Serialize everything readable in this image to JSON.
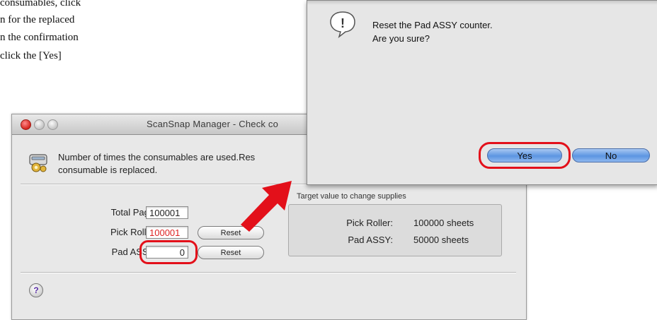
{
  "doc": {
    "line1": "consumables, click",
    "line2": "n  for  the  replaced",
    "line3": "n  the  confirmation",
    "line4": "click  the  [Yes]"
  },
  "main_window": {
    "title": "ScanSnap Manager - Check co",
    "info_line1": "Number of times the consumables are used.Res",
    "info_line2": "consumable is replaced.",
    "total_label": "Total Page Count:",
    "total_value": "100001",
    "pick_label": "Pick Roller Count:",
    "pick_value": "100001",
    "pad_label": "Pad ASSY Count:",
    "pad_value": "0",
    "reset_label": "Reset",
    "group_title": "Target value to change supplies",
    "target_pick_name": "Pick Roller:",
    "target_pick_value": "100000  sheets",
    "target_pad_name": "Pad ASSY:",
    "target_pad_value": "50000  sheets",
    "help_symbol": "?"
  },
  "dialog": {
    "message_line1": "Reset the Pad ASSY counter.",
    "message_line2": "Are you sure?",
    "yes_label": "Yes",
    "no_label": "No",
    "alert_symbol": "!"
  },
  "colors": {
    "highlight": "#e3101a",
    "arrow": "#e3101a",
    "warning_value": "#d22222",
    "button_blue": "#5c95e2"
  },
  "icons": {
    "info": "scanner-gear-icon",
    "alert": "exclamation-speech-icon",
    "arrow": "red-arrow-icon",
    "help": "help-icon"
  }
}
